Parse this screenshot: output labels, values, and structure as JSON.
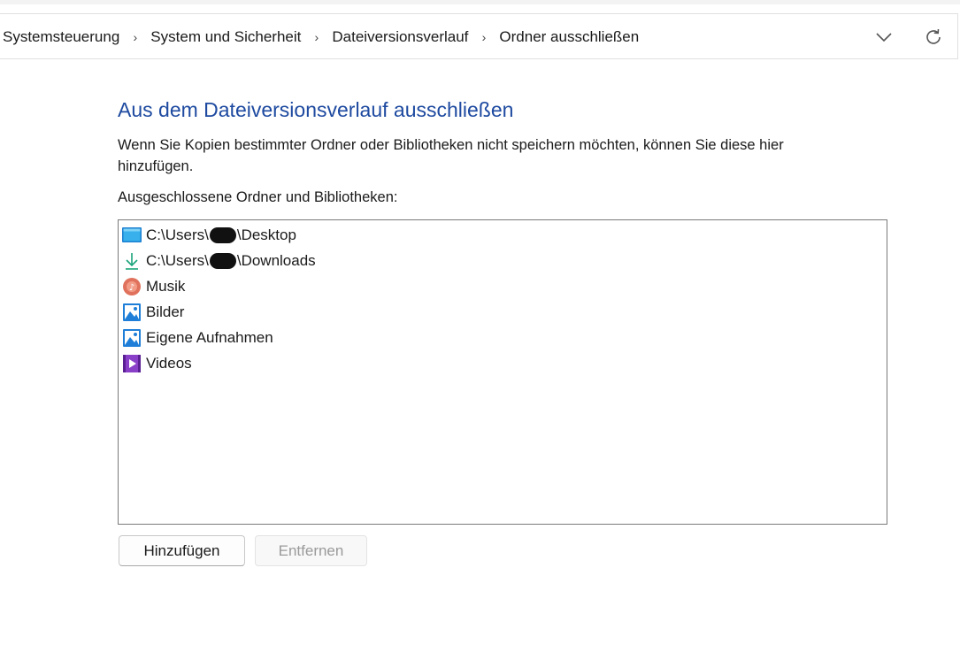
{
  "breadcrumb": {
    "items": [
      {
        "label": "Systemsteuerung"
      },
      {
        "label": "System und Sicherheit"
      },
      {
        "label": "Dateiversionsverlauf"
      },
      {
        "label": "Ordner ausschließen"
      }
    ],
    "separator": "›"
  },
  "toolbar": {
    "dropdown_icon": "chevron-down-icon",
    "refresh_icon": "refresh-icon"
  },
  "main": {
    "title": "Aus dem Dateiversionsverlauf ausschließen",
    "description": "Wenn Sie Kopien bestimmter Ordner oder Bibliotheken nicht speichern möchten, können Sie diese hier hinzufügen.",
    "list_label": "Ausgeschlossene Ordner und Bibliotheken:",
    "excluded_items": [
      {
        "icon": "desktop-folder-icon",
        "prefix": "C:\\Users\\",
        "redacted": true,
        "suffix": "\\Desktop"
      },
      {
        "icon": "downloads-icon",
        "prefix": "C:\\Users\\",
        "redacted": true,
        "suffix": "\\Downloads"
      },
      {
        "icon": "music-icon",
        "prefix": "Musik",
        "redacted": false,
        "suffix": ""
      },
      {
        "icon": "pictures-icon",
        "prefix": "Bilder",
        "redacted": false,
        "suffix": ""
      },
      {
        "icon": "pictures-icon",
        "prefix": "Eigene Aufnahmen",
        "redacted": false,
        "suffix": ""
      },
      {
        "icon": "videos-icon",
        "prefix": "Videos",
        "redacted": false,
        "suffix": ""
      }
    ]
  },
  "buttons": {
    "add_label": "Hinzufügen",
    "remove_label": "Entfernen",
    "remove_enabled": false
  },
  "colors": {
    "title": "#1e4aa0",
    "disabled_text": "#9a9a9a"
  }
}
